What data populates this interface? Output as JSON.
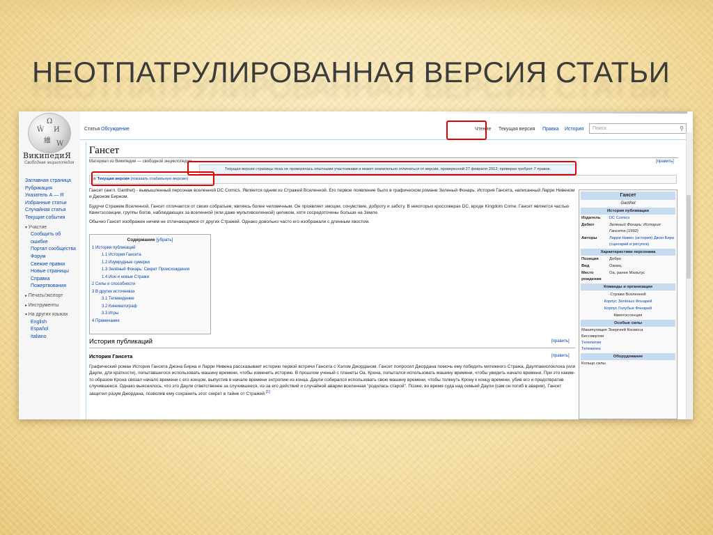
{
  "slide": {
    "title": "НЕОТПАТРУЛИРОВАННАЯ ВЕРСИЯ СТАТЬИ"
  },
  "colors": {
    "link": "#0645ad",
    "highlight": "#e00000",
    "infobox_header": "#c6dbef"
  },
  "wiki": {
    "logo_word": "ВикипедиЯ",
    "logo_sub": "Свободная энциклопедия",
    "nav": {
      "main": [
        "Заглавная страница",
        "Рубрикация",
        "Указатель А — Я",
        "Избранные статьи",
        "Случайная статья",
        "Текущие события"
      ],
      "participation_header": "Участие",
      "participation": [
        "Сообщить об",
        "ошибке",
        "Портал сообщества",
        "Форум",
        "Свежие правки",
        "Новые страницы",
        "Справка",
        "Пожертвования"
      ],
      "print_header": "Печать/экспорт",
      "tools_header": "Инструменты",
      "languages_header": "На других языках",
      "languages": [
        "English",
        "Español",
        "Italiano"
      ]
    },
    "tabs": {
      "article": "Статья",
      "discussion": "Обсуждение",
      "read": "Чтение",
      "current_version": "Текущая версия",
      "edit": "Правка",
      "history": "История",
      "search_placeholder": "Поиск"
    },
    "page": {
      "title": "Гансет",
      "subtitle": "Материал из Википедии — свободной энциклопедии",
      "edit_label": "[править]",
      "notice": "Текущая версия страницы пока не проверялась опытными участниками и может значительно отличаться от версии, проверенной 27 февраля 2012; проверки требуют 7 правок.",
      "current_version_label": "Текущая версия",
      "current_version_hint": "(показать стабильную версию)"
    },
    "intro": [
      "Гансет (англ. Ganthet) - вымышленный персонаж вселенной DC Comics. Является одним из Стражей Вселенной. Его первое появление было в графическом романе Зеленый Фонарь: История Гансета, написанный Ларри Нивеном и Джоном Бирном.",
      "Будучи Стражем Вселенной, Гансет отличается от своих собратьев, являясь более человечным. Он проявляет эмоции, сочувствие, доброту и заботу. В некоторых кроссоверах DC, вроде Kingdom Come, Гансет является частью Квинтэссенции, группы богов, наблюдающих за вселенной (или даже мультивселенной) целиком, хотя сосредоточены больше на Земле.",
      "Обычно Гансет изображен ничем не отличающимся от других Стражей. Однако довольно часто его изображали с длинным хвостом."
    ],
    "toc": {
      "title": "Содержание",
      "toggle": "[убрать]",
      "items": [
        {
          "text": "1 История публикаций",
          "level": 1
        },
        {
          "text": "1.1 История Гансета",
          "level": 2
        },
        {
          "text": "1.2 Изумрудные сумерки",
          "level": 2
        },
        {
          "text": "1.3 Зелёный Фонарь: Секрет Происхождения",
          "level": 2
        },
        {
          "text": "1.4 Ион и новые Стражи",
          "level": 2
        },
        {
          "text": "2 Силы и способности",
          "level": 1
        },
        {
          "text": "3 В других источниках",
          "level": 1
        },
        {
          "text": "3.1 Телевидение",
          "level": 2
        },
        {
          "text": "3.2 Кинематограф",
          "level": 2
        },
        {
          "text": "3.3 Игры",
          "level": 2
        },
        {
          "text": "4 Примечания",
          "level": 1
        }
      ]
    },
    "section1": {
      "title": "История публикаций",
      "subsection": "История Гансета",
      "text": "Графический роман История Гансета Джона Бирна и Ларри Нивена рассказывает историю первой встречи Гансета с Хэлом Джорданом. Гансет попросил Джордана помочь ему победить мятежного Стража, Даулпакиспоклока (или Даули, для краткости), попытавшегося использовать машину времени, чтобы изменить историю. В прошлом ученый с планеты Оа, Крона, попытался использовать машину времени, чтобы увидеть начало времени. При это каким-то образом Крона связал начало времени с его концом, выпустив в начале времени энтропию из конца. Даули собирался использовать свою машину времени, чтобы толкнуть Крону к концу времени, убив его и предотвратив случившееся. Однако выяснилось, что это Даули ответственен за случившееся, из-за его действий и случайной аварии вселенная \"родилась старой\". Позже, во время суда над семьей Даули (сам он погиб в аварии), Гансет защитил разум Джордана, позволив ему сохранить этот секрет в тайне от Стражей.",
      "ref": "[1]"
    },
    "infobox": {
      "title": "Гансет",
      "original": "Ganthet",
      "sec_publication": "История публикации",
      "rows": [
        {
          "k": "Издатель",
          "v": "DC Comics",
          "style": "link"
        },
        {
          "k": "Дебют",
          "v": "Зеленый Фонарь: История Гансета (1992)",
          "style": "it"
        },
        {
          "k": "Авторы",
          "v": "Ларри Нивен (история) Джон Бирн (сценарий и рисунок)",
          "style": "link"
        }
      ],
      "sec_character": "Характеристики персонажа",
      "char_rows": [
        {
          "k": "Позиция",
          "v": "Добро"
        },
        {
          "k": "Вид",
          "v": "Оанец"
        },
        {
          "k": "Место рождения",
          "v": "Оа, ранее Мальтус"
        }
      ],
      "sec_teams": "Команды и организации",
      "teams": [
        "Стражи Вселенной",
        "Корпус Зелёных Фонарей",
        "Корпус Голубых Фонарей",
        "Квинтэссенция"
      ],
      "sec_powers": "Особые силы",
      "powers": [
        "Манипуляция Энергией Космоса",
        "Бессмертия",
        "Телепатия",
        "Телекинез"
      ],
      "sec_equipment": "Оборудование",
      "equipment": [
        "Кольцо силы"
      ]
    }
  }
}
